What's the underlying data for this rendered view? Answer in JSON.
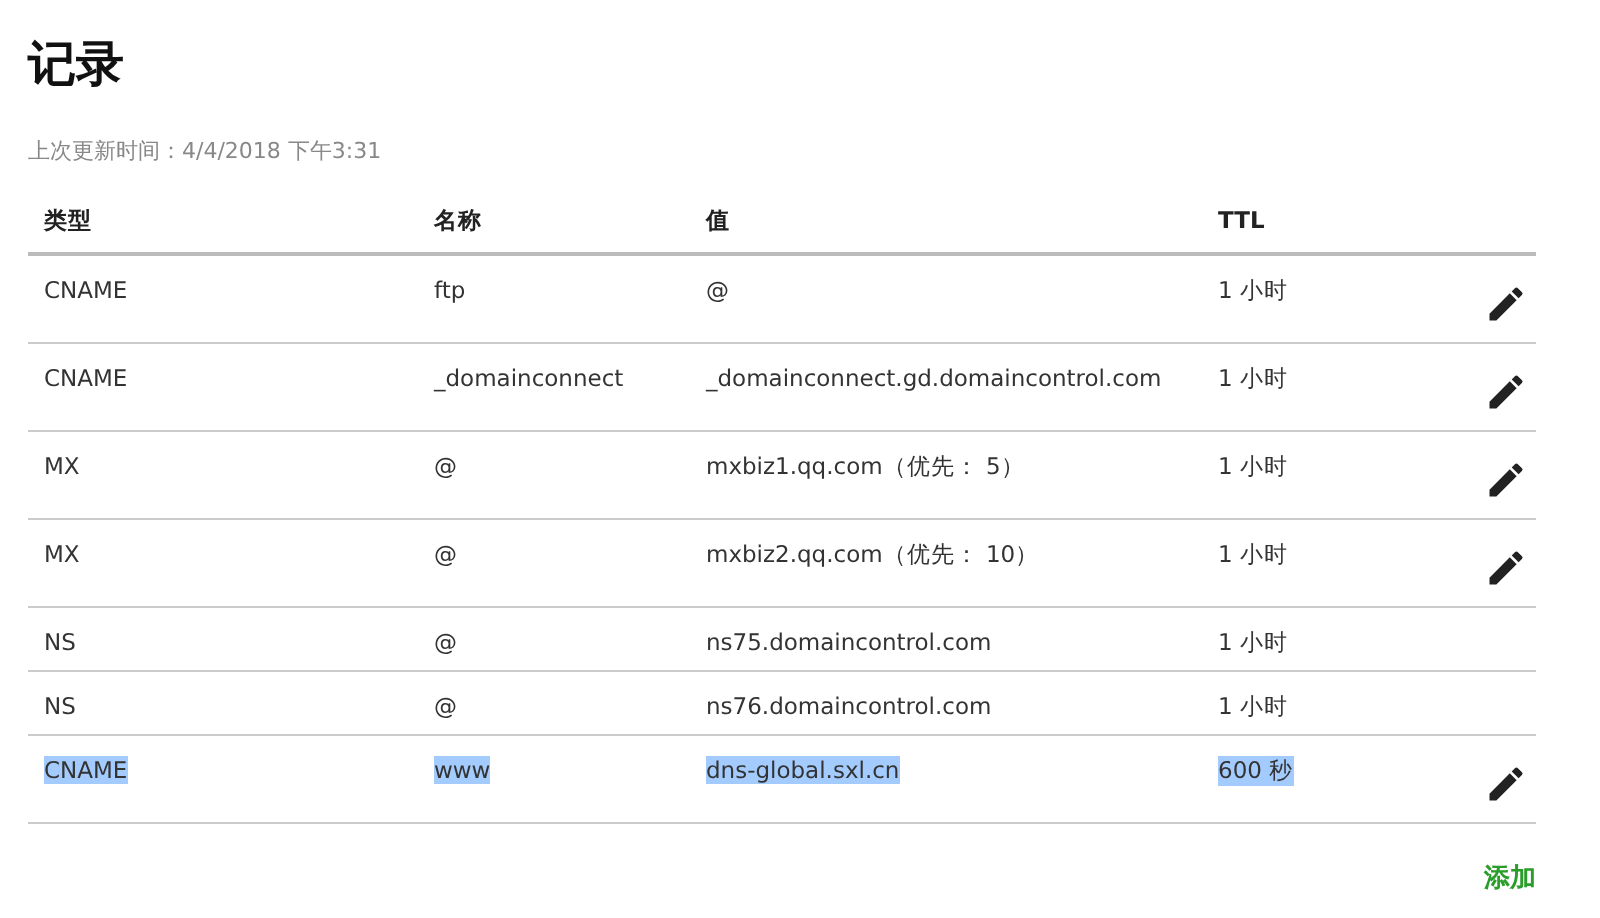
{
  "title": "记录",
  "updated": "上次更新时间：4/4/2018 下午3:31",
  "table": {
    "columns": [
      "类型",
      "名称",
      "值",
      "TTL"
    ],
    "rows": [
      {
        "cells": [
          "CNAME",
          "ftp",
          "@",
          "1 小时"
        ],
        "editable": true,
        "selected": false
      },
      {
        "cells": [
          "CNAME",
          "_domainconnect",
          "_domainconnect.gd.domaincontrol.com",
          "1 小时"
        ],
        "editable": true,
        "selected": false
      },
      {
        "cells": [
          "MX",
          "@",
          "mxbiz1.qq.com（优先： 5）",
          "1 小时"
        ],
        "editable": true,
        "selected": false
      },
      {
        "cells": [
          "MX",
          "@",
          "mxbiz2.qq.com（优先： 10）",
          "1 小时"
        ],
        "editable": true,
        "selected": false
      },
      {
        "cells": [
          "NS",
          "@",
          "ns75.domaincontrol.com",
          "1 小时"
        ],
        "editable": false,
        "selected": false
      },
      {
        "cells": [
          "NS",
          "@",
          "ns76.domaincontrol.com",
          "1 小时"
        ],
        "editable": false,
        "selected": false
      },
      {
        "cells": [
          "CNAME",
          "www",
          "dns-global.sxl.cn",
          "600 秒"
        ],
        "editable": true,
        "selected": true
      }
    ]
  },
  "add_link": "添加"
}
